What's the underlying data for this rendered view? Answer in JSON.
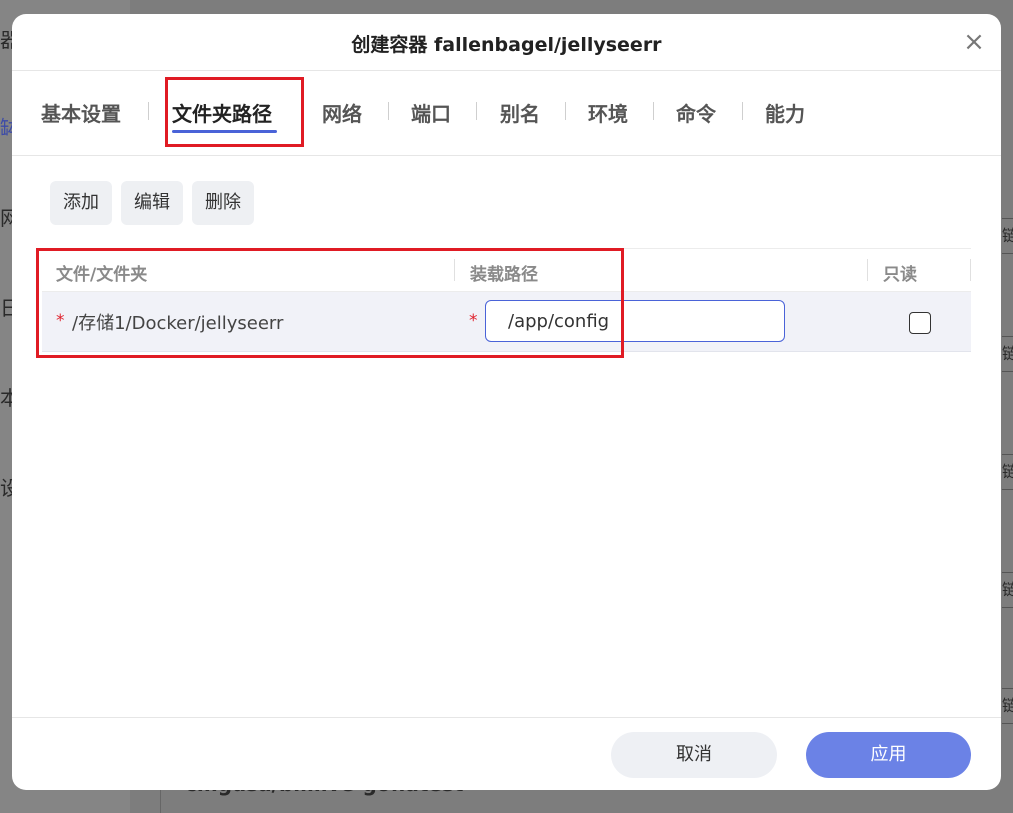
{
  "background": {
    "left_items": [
      "器",
      "缽",
      "网",
      "日",
      "本",
      "设"
    ],
    "right_items": [
      "链",
      "链",
      "链",
      "链",
      "链"
    ],
    "bottom_text": "cmgusa/bililive-go:latest"
  },
  "dialog": {
    "title": "创建容器 fallenbagel/jellyseerr",
    "close_symbol": "×"
  },
  "tabs": [
    {
      "label": "基本设置",
      "active": false
    },
    {
      "label": "文件夹路径",
      "active": true
    },
    {
      "label": "网络",
      "active": false
    },
    {
      "label": "端口",
      "active": false
    },
    {
      "label": "别名",
      "active": false
    },
    {
      "label": "环境",
      "active": false
    },
    {
      "label": "命令",
      "active": false
    },
    {
      "label": "能力",
      "active": false
    }
  ],
  "toolbar": {
    "add_label": "添加",
    "edit_label": "编辑",
    "delete_label": "删除"
  },
  "table": {
    "headers": [
      "文件/文件夹",
      "装载路径",
      "只读"
    ],
    "rows": [
      {
        "required_mark": "*",
        "folder": "/存储1/Docker/jellyseerr",
        "mount_path": "/app/config",
        "read_only": false
      }
    ]
  },
  "footer": {
    "cancel_label": "取消",
    "apply_label": "应用"
  },
  "colors": {
    "accent": "#4a63d8",
    "apply_button": "#6b82e6",
    "highlight_box": "#e01b24",
    "required": "#e0232e"
  }
}
